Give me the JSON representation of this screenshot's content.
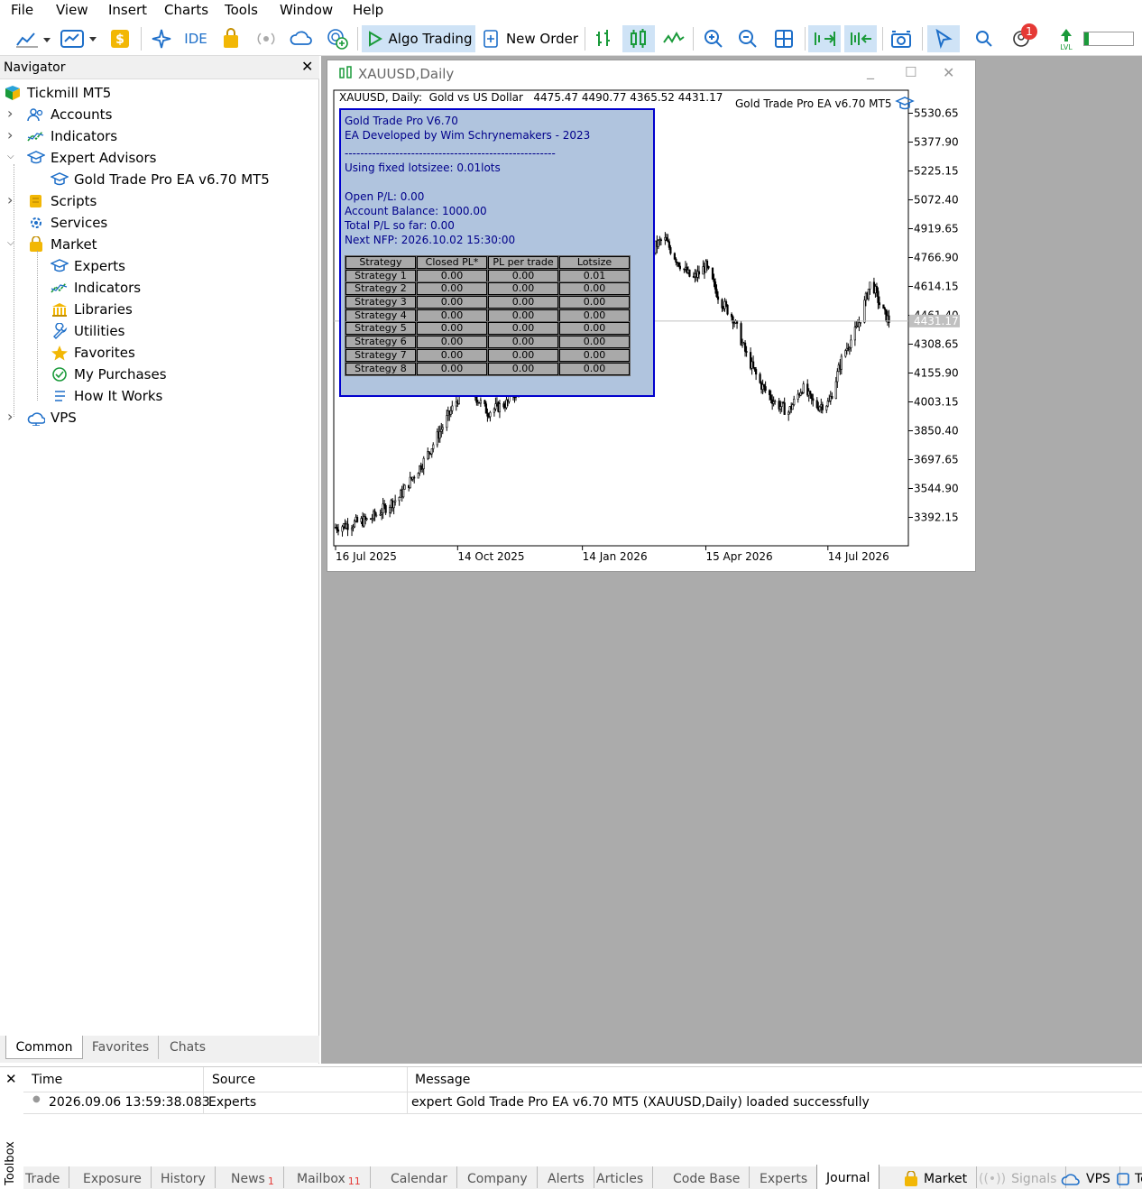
{
  "menu": [
    "File",
    "View",
    "Insert",
    "Charts",
    "Tools",
    "Window",
    "Help"
  ],
  "toolbar": {
    "ide": "IDE",
    "algo_trading": "Algo Trading",
    "new_order": "New Order",
    "notification_count": "1"
  },
  "navigator": {
    "title": "Navigator",
    "root": "Tickmill MT5",
    "items": [
      {
        "label": "Accounts",
        "icon": "accounts-icon",
        "level": 1,
        "chev": "right"
      },
      {
        "label": "Indicators",
        "icon": "indicators-icon",
        "level": 1,
        "chev": "right"
      },
      {
        "label": "Expert Advisors",
        "icon": "expert-advisors-icon",
        "level": 1,
        "chev": "down"
      },
      {
        "label": "Gold Trade Pro EA v6.70 MT5",
        "icon": "expert-icon",
        "level": 2,
        "chev": ""
      },
      {
        "label": "Scripts",
        "icon": "scripts-icon",
        "level": 1,
        "chev": "right"
      },
      {
        "label": "Services",
        "icon": "services-icon",
        "level": 1,
        "chev": ""
      },
      {
        "label": "Market",
        "icon": "market-icon",
        "level": 1,
        "chev": "down"
      },
      {
        "label": "Experts",
        "icon": "experts-icon",
        "level": 2,
        "chev": ""
      },
      {
        "label": "Indicators",
        "icon": "indicators-icon",
        "level": 2,
        "chev": ""
      },
      {
        "label": "Libraries",
        "icon": "libraries-icon",
        "level": 2,
        "chev": ""
      },
      {
        "label": "Utilities",
        "icon": "utilities-icon",
        "level": 2,
        "chev": ""
      },
      {
        "label": "Favorites",
        "icon": "favorites-icon",
        "level": 2,
        "chev": ""
      },
      {
        "label": "My Purchases",
        "icon": "purchases-icon",
        "level": 2,
        "chev": ""
      },
      {
        "label": "How It Works",
        "icon": "how-it-works-icon",
        "level": 2,
        "chev": ""
      },
      {
        "label": "VPS",
        "icon": "vps-icon",
        "level": 1,
        "chev": "right"
      }
    ],
    "tabs": [
      "Common",
      "Favorites",
      "Chats"
    ]
  },
  "chart_window": {
    "title": "XAUUSD,Daily",
    "header": "XAUUSD, Daily:  Gold vs US Dollar   4475.47 4490.77 4365.52 4431.17",
    "ea_label": "Gold Trade Pro EA v6.70 MT5",
    "current_price": "4431.17"
  },
  "ea_panel": {
    "lines": [
      "Gold Trade Pro V6.70",
      "EA Developed by Wim Schrynemakers - 2023",
      "------------------------------------------------------",
      "Using fixed lotsizee: 0.01lots",
      "",
      "Open P/L: 0.00",
      "Account Balance: 1000.00",
      "Total P/L so far: 0.00",
      "Next NFP: 2026.10.02 15:30:00"
    ],
    "table_headers": [
      "Strategy",
      "Closed PL*",
      "PL per trade",
      "Lotsize"
    ],
    "rows": [
      [
        "Strategy 1",
        "0.00",
        "0.00",
        "0.01"
      ],
      [
        "Strategy 2",
        "0.00",
        "0.00",
        "0.00"
      ],
      [
        "Strategy 3",
        "0.00",
        "0.00",
        "0.00"
      ],
      [
        "Strategy 4",
        "0.00",
        "0.00",
        "0.00"
      ],
      [
        "Strategy 5",
        "0.00",
        "0.00",
        "0.00"
      ],
      [
        "Strategy 6",
        "0.00",
        "0.00",
        "0.00"
      ],
      [
        "Strategy 7",
        "0.00",
        "0.00",
        "0.00"
      ],
      [
        "Strategy 8",
        "0.00",
        "0.00",
        "0.00"
      ]
    ]
  },
  "chart_data": {
    "type": "candlestick",
    "symbol": "XAUUSD",
    "timeframe": "Daily",
    "ohlc_last": {
      "open": 4475.47,
      "high": 4490.77,
      "low": 4365.52,
      "close": 4431.17
    },
    "y_ticks": [
      5530.65,
      5377.9,
      5225.15,
      5072.4,
      4919.65,
      4766.9,
      4614.15,
      4461.4,
      4308.65,
      4155.9,
      4003.15,
      3850.4,
      3697.65,
      3544.9,
      3392.15
    ],
    "y_tick_labels": [
      "5530.65",
      "5377.90",
      "5225.15",
      "5072.40",
      "4919.65",
      "4766.90",
      "4614.15",
      "4461.40",
      "4308.65",
      "4155.90",
      "4003.15",
      "3850.40",
      "3697.65",
      "3544.90",
      "3392.15"
    ],
    "x_tick_labels": [
      "16 Jul 2025",
      "14 Oct 2025",
      "14 Jan 2026",
      "15 Apr 2026",
      "14 Jul 2026"
    ],
    "ylim": [
      3290,
      5600
    ],
    "series_approx": [
      {
        "date": "2025-07-16",
        "close": 3340
      },
      {
        "date": "2025-08-10",
        "close": 3380
      },
      {
        "date": "2025-09-01",
        "close": 3500
      },
      {
        "date": "2025-09-20",
        "close": 3700
      },
      {
        "date": "2025-10-05",
        "close": 3900
      },
      {
        "date": "2025-10-20",
        "close": 4100
      },
      {
        "date": "2025-11-05",
        "close": 3950
      },
      {
        "date": "2025-11-20",
        "close": 4000
      },
      {
        "date": "2025-12-10",
        "close": 4200
      },
      {
        "date": "2026-01-05",
        "close": 4350
      },
      {
        "date": "2026-02-01",
        "close": 4500
      },
      {
        "date": "2026-02-20",
        "close": 4600
      },
      {
        "date": "2026-03-05",
        "close": 4800
      },
      {
        "date": "2026-03-15",
        "close": 4870
      },
      {
        "date": "2026-03-25",
        "close": 4750
      },
      {
        "date": "2026-04-05",
        "close": 4650
      },
      {
        "date": "2026-04-15",
        "close": 4720
      },
      {
        "date": "2026-04-25",
        "close": 4550
      },
      {
        "date": "2026-05-05",
        "close": 4450
      },
      {
        "date": "2026-05-15",
        "close": 4250
      },
      {
        "date": "2026-05-25",
        "close": 4100
      },
      {
        "date": "2026-06-05",
        "close": 4000
      },
      {
        "date": "2026-06-15",
        "close": 3950
      },
      {
        "date": "2026-06-25",
        "close": 4080
      },
      {
        "date": "2026-07-05",
        "close": 3980
      },
      {
        "date": "2026-07-15",
        "close": 4000
      },
      {
        "date": "2026-07-25",
        "close": 4250
      },
      {
        "date": "2026-08-05",
        "close": 4400
      },
      {
        "date": "2026-08-15",
        "close": 4650
      },
      {
        "date": "2026-08-22",
        "close": 4500
      },
      {
        "date": "2026-08-28",
        "close": 4431.17
      }
    ]
  },
  "toolbox": {
    "label": "Toolbox",
    "columns": [
      "Time",
      "Source",
      "Message"
    ],
    "rows": [
      [
        "2026.09.06 13:59:38.083",
        "Experts",
        "expert Gold Trade Pro EA v6.70 MT5 (XAUUSD,Daily) loaded successfully"
      ]
    ],
    "tabs": [
      "Trade",
      "Exposure",
      "History",
      "News",
      "Mailbox",
      "Calendar",
      "Company",
      "Alerts",
      "Articles",
      "Code Base",
      "Experts",
      "Journal",
      "Market",
      "Signals",
      "VPS",
      "Te"
    ],
    "news_badge": "1",
    "mailbox_badge": "11",
    "active_tab": "Journal"
  },
  "colors": {
    "accent": "#1e6fc9",
    "panel_bg": "#b0c4de",
    "panel_text": "#00008b",
    "badge": "#e53935",
    "green": "#1a9a3a"
  }
}
